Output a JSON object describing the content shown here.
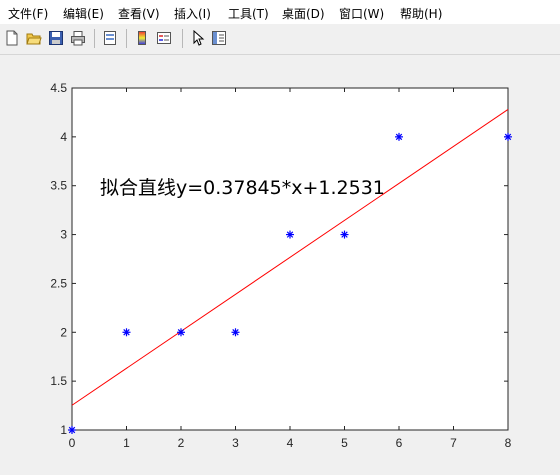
{
  "menu": [
    "文件(F)",
    "编辑(E)",
    "查看(V)",
    "插入(I)",
    "工具(T)",
    "桌面(D)",
    "窗口(W)",
    "帮助(H)"
  ],
  "toolbar_icons": [
    "new-file-icon",
    "open-folder-icon",
    "save-icon",
    "print-icon",
    "print-preview-icon",
    "colorbar-icon",
    "legend-icon",
    "pointer-icon",
    "property-editor-icon"
  ],
  "chart_data": {
    "type": "scatter",
    "annotation": "拟合直线y=0.37845*x+1.2531",
    "x": [
      0,
      1,
      2,
      3,
      4,
      5,
      6,
      8
    ],
    "y": [
      1,
      2,
      2,
      2,
      3,
      3,
      4,
      4
    ],
    "fit_line": {
      "slope": 0.37845,
      "intercept": 1.2531
    },
    "xlim": [
      0,
      8
    ],
    "ylim": [
      1,
      4.5
    ],
    "xticks": [
      "0",
      "1",
      "2",
      "3",
      "4",
      "5",
      "6",
      "7",
      "8"
    ],
    "yticks": [
      "1",
      "1.5",
      "2",
      "2.5",
      "3",
      "3.5",
      "4",
      "4.5"
    ],
    "marker": "*",
    "marker_color": "#0000ff",
    "line_color": "#ff0000",
    "grid": false
  }
}
